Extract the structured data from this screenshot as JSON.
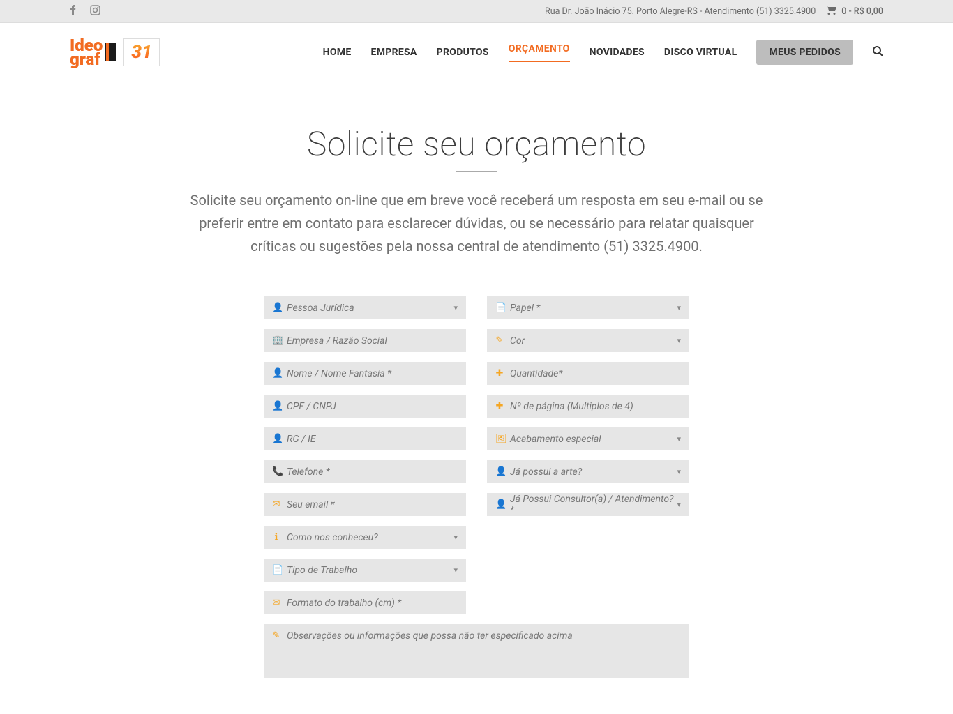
{
  "topbar": {
    "address": "Rua Dr. João Inácio 75. Porto Alegre-RS - Atendimento (51) 3325.4900",
    "cart": "0 - R$ 0,00"
  },
  "nav": {
    "home": "HOME",
    "empresa": "EMPRESA",
    "produtos": "PRODUTOS",
    "orcamento": "ORÇAMENTO",
    "novidades": "NOVIDADES",
    "disco": "DISCO VIRTUAL",
    "pedidos": "MEUS PEDIDOS"
  },
  "page": {
    "title": "Solicite seu orçamento",
    "subtitle": "Solicite seu orçamento on-line que em breve você receberá um resposta em seu e-mail ou se preferir entre em contato para esclarecer dúvidas, ou se necessário para relatar quaisquer críticas ou sugestões pela nossa central de atendimento (51) 3325.4900."
  },
  "left": {
    "tipo_pessoa": "Pessoa Jurídica",
    "empresa": "Empresa / Razão Social",
    "nome": "Nome / Nome Fantasia *",
    "cpf": "CPF / CNPJ",
    "rg": "RG / IE",
    "telefone": "Telefone *",
    "email": "Seu email *",
    "conheceu": "Como nos conheceu?",
    "tipo_trabalho": "Tipo de Trabalho",
    "formato": "Formato do trabalho (cm) *"
  },
  "right": {
    "papel": "Papel *",
    "cor": "Cor",
    "quantidade": "Quantidade*",
    "paginas": "Nº de página (Multiplos de 4)",
    "acabamento": "Acabamento especial",
    "arte": "Já possui a arte?",
    "consultor": "Já Possui Consultor(a) / Atendimento? *"
  },
  "obs": "Observações ou informações que possa não ter especificado acima",
  "logo": {
    "l1": "Ideo",
    "l2": "graf",
    "anos": "31"
  }
}
